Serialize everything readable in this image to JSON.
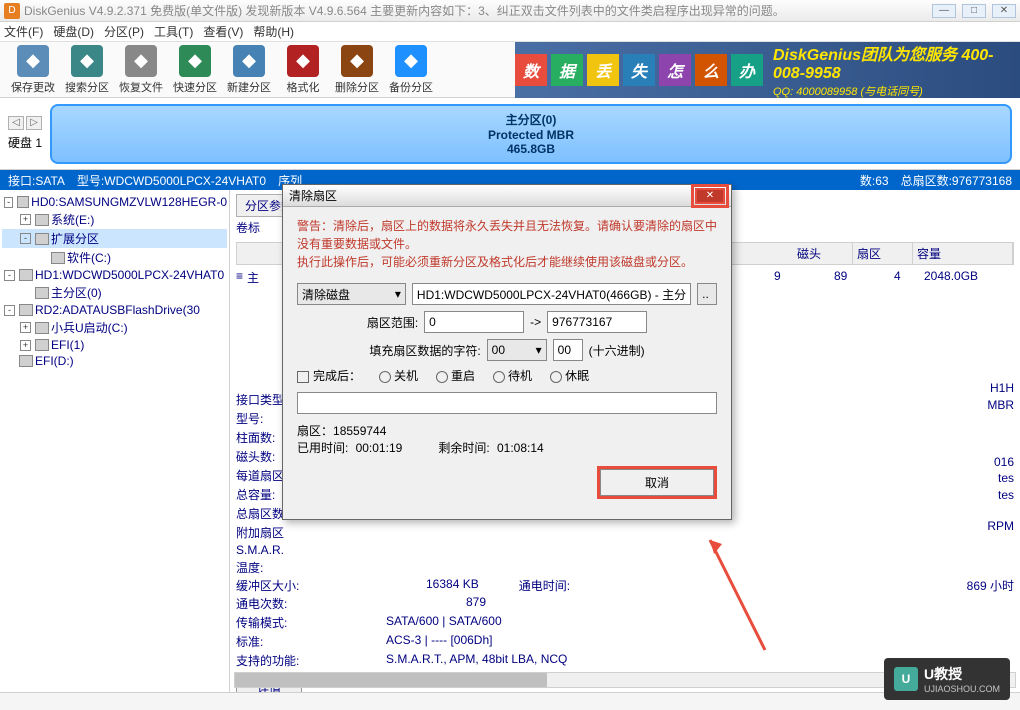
{
  "title": "DiskGenius V4.9.2.371 免费版(单文件版)   发现新版本 V4.9.6.564 主要更新内容如下：3、纠正双击文件列表中的文件类启程序出现异常的问题。",
  "menu": [
    "文件(F)",
    "硬盘(D)",
    "分区(P)",
    "工具(T)",
    "查看(V)",
    "帮助(H)"
  ],
  "tools": [
    {
      "label": "保存更改",
      "color": "#5b8db8"
    },
    {
      "label": "搜索分区",
      "color": "#3b8686"
    },
    {
      "label": "恢复文件",
      "color": "#888"
    },
    {
      "label": "快速分区",
      "color": "#2e8b57"
    },
    {
      "label": "新建分区",
      "color": "#4682b4"
    },
    {
      "label": "格式化",
      "color": "#b22222"
    },
    {
      "label": "删除分区",
      "color": "#8b4513"
    },
    {
      "label": "备份分区",
      "color": "#1e90ff"
    }
  ],
  "banner_blocks": [
    "数",
    "据",
    "丢",
    "失",
    "怎",
    "么",
    "办"
  ],
  "banner_colors": [
    "#e74c3c",
    "#27ae60",
    "#f1c40f",
    "#2980b9",
    "#8e44ad",
    "#d35400",
    "#16a085"
  ],
  "banner_text": "DiskGenius团队为您服务 400-008-9958",
  "banner_sub": "QQ: 4000089958 (与电话同号)",
  "nav": {
    "disk_label": "硬盘 1"
  },
  "partbox": {
    "line1": "主分区(0)",
    "line2": "Protected MBR",
    "line3": "465.8GB"
  },
  "status": {
    "iface": "接口:SATA",
    "model": "型号:WDCWD5000LPCX-24VHAT0",
    "seq": "序列",
    "head": "数:63",
    "total": "总扇区数:976773168"
  },
  "tree": [
    {
      "ind": 0,
      "exp": "-",
      "txt": "HD0:SAMSUNGMZVLW128HEGR-0"
    },
    {
      "ind": 1,
      "exp": "+",
      "txt": "系统(E:)"
    },
    {
      "ind": 1,
      "exp": "-",
      "txt": "扩展分区",
      "sel": true
    },
    {
      "ind": 2,
      "exp": "",
      "txt": "软件(C:)"
    },
    {
      "ind": 0,
      "exp": "-",
      "txt": "HD1:WDCWD5000LPCX-24VHAT0"
    },
    {
      "ind": 1,
      "exp": "",
      "txt": "主分区(0)"
    },
    {
      "ind": 0,
      "exp": "-",
      "txt": "RD2:ADATAUSBFlashDrive(30"
    },
    {
      "ind": 1,
      "exp": "+",
      "txt": "小兵U启动(C:)"
    },
    {
      "ind": 1,
      "exp": "+",
      "txt": "EFI(1)"
    },
    {
      "ind": 0,
      "exp": "",
      "txt": "EFI(D:)"
    }
  ],
  "detail": {
    "tabs": [
      "分区参数",
      "..."
    ],
    "volume": "卷标",
    "main": "主",
    "hdr": [
      "",
      "磁头",
      "扇区",
      "容量"
    ],
    "row": [
      "9",
      "89",
      "4",
      "2048.0GB"
    ],
    "info": [
      {
        "l": "接口类型",
        "v": ""
      },
      {
        "l": "型号:",
        "v": ""
      },
      {
        "l": "柱面数:",
        "v": ""
      },
      {
        "l": "磁头数:",
        "v": ""
      },
      {
        "l": "每道扇区",
        "v": ""
      },
      {
        "l": "总容量:",
        "v": ""
      },
      {
        "l": "总扇区数",
        "v": ""
      },
      {
        "l": "附加扇区",
        "v": ""
      },
      {
        "l": "S.M.A.R.",
        "v": ""
      },
      {
        "l": "温度:",
        "v": ""
      }
    ],
    "extra": {
      "h1h": "H1H",
      "mbr": "MBR",
      "n016": "016",
      "tes1": "tes",
      "tes2": "tes",
      "rpm": "RPM",
      "buf_l": "缓冲区大小:",
      "buf_v": "16384 KB",
      "pow_l": "通电时间:",
      "pow_v": "869 小时",
      "cnt_l": "通电次数:",
      "cnt_v": "879",
      "mode_l": "传输模式:",
      "mode_v": "SATA/600 | SATA/600",
      "std_l": "标准:",
      "std_v": "ACS-3 | ---- [006Dh]",
      "sup_l": "支持的功能:",
      "sup_v": "S.M.A.R.T., APM, 48bit LBA, NCQ"
    },
    "detail_btn": "详情"
  },
  "dialog": {
    "title": "清除扇区",
    "warn": "警告：清除后，扇区上的数据将永久丢失并且无法恢复。请确认要清除的扇区中没有重要数据或文件。\n执行此操作后，可能必须重新分区及格式化后才能继续使用该磁盘或分区。",
    "clear_lbl": "清除磁盘",
    "clear_val": "HD1:WDCWD5000LPCX-24VHAT0(466GB) - 主分",
    "range_lbl": "扇区范围:",
    "range_from": "0",
    "range_arrow": "->",
    "range_to": "976773167",
    "fill_lbl": "填充扇区数据的字符:",
    "fill_v1": "00",
    "fill_v2": "00",
    "fill_hex": "(十六进制)",
    "after_lbl": "完成后：",
    "opts": [
      "关机",
      "重启",
      "待机",
      "休眠"
    ],
    "sector_l": "扇区：",
    "sector_v": "18559744",
    "elapsed_l": "已用时间:",
    "elapsed_v": "00:01:19",
    "remain_l": "剩余时间:",
    "remain_v": "01:08:14",
    "cancel": "取消"
  },
  "watermark": {
    "title": "U教授",
    "sub": "UJIAOSHOU.COM"
  }
}
